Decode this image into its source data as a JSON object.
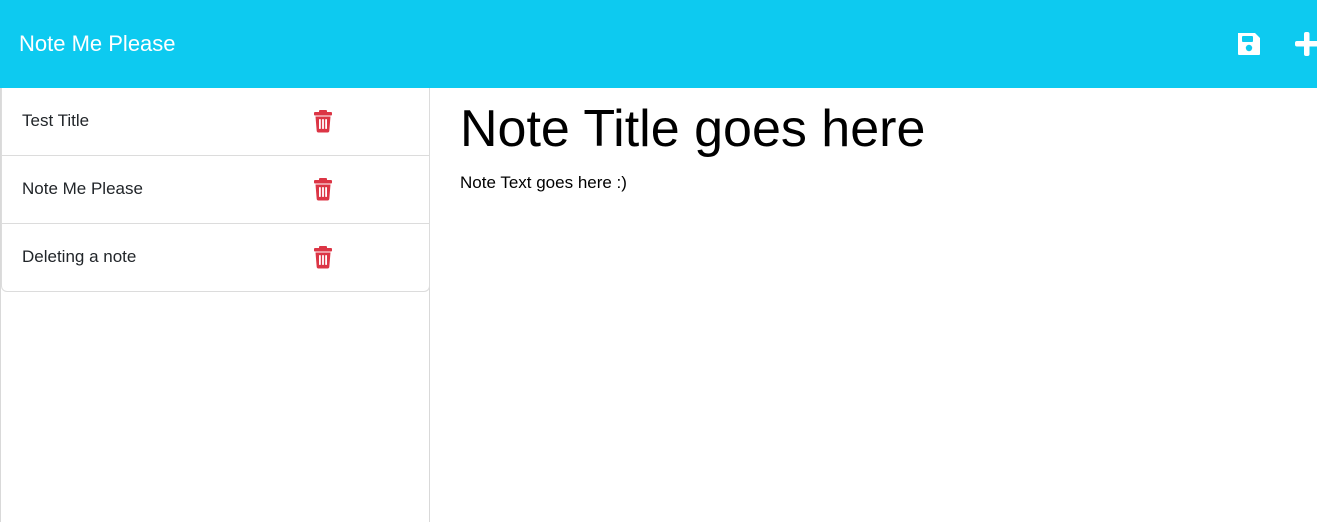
{
  "header": {
    "brand": "Note Me Please",
    "save_icon": "floppy-disk-icon",
    "add_icon": "plus-icon",
    "background_color": "#0dcaf0"
  },
  "notes": [
    {
      "title": "Test Title",
      "delete_icon": "trash-icon"
    },
    {
      "title": "Note Me Please",
      "delete_icon": "trash-icon"
    },
    {
      "title": "Deleting a note",
      "delete_icon": "trash-icon"
    }
  ],
  "editor": {
    "title_placeholder": "Note Title goes here",
    "text_placeholder": "Note Text goes here :)"
  },
  "colors": {
    "delete": "#dc3545",
    "header_text": "#ffffff"
  }
}
